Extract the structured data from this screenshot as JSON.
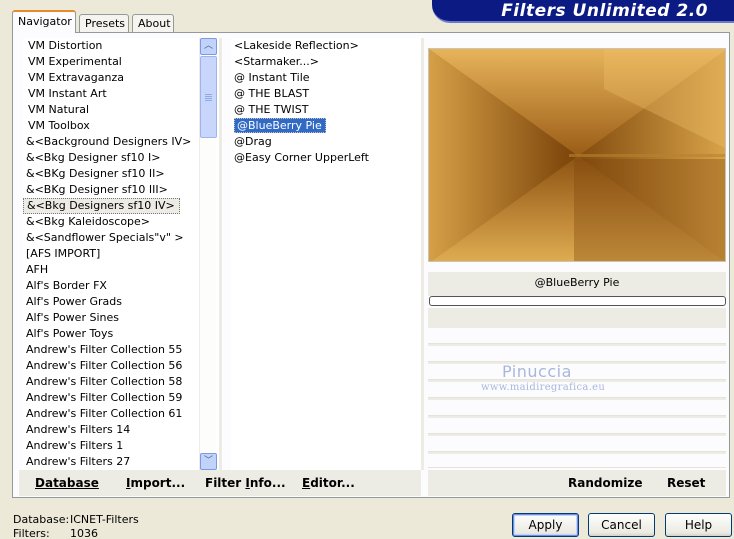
{
  "banner": {
    "title": "Filters Unlimited 2.0"
  },
  "tabs": [
    {
      "label": "Navigator",
      "active": true
    },
    {
      "label": "Presets",
      "active": false
    },
    {
      "label": "About",
      "active": false
    }
  ],
  "categories": [
    "VM Distortion",
    "VM Experimental",
    "VM Extravaganza",
    "VM Instant Art",
    "VM Natural",
    "VM Toolbox",
    "&<Background Designers IV>",
    "&<Bkg Designer sf10 I>",
    "&<BKg Designer sf10 II>",
    "&<BKg Designer sf10 III>",
    "&<Bkg Designers sf10 IV>",
    "&<Bkg Kaleidoscope>",
    "&<Sandflower Specials\"v\" >",
    "[AFS IMPORT]",
    "AFH",
    "Alf's Border FX",
    "Alf's Power Grads",
    "Alf's Power Sines",
    "Alf's Power Toys",
    "Andrew's Filter Collection 55",
    "Andrew's Filter Collection 56",
    "Andrew's Filter Collection 58",
    "Andrew's Filter Collection 59",
    "Andrew's Filter Collection 61",
    "Andrew's Filters 14",
    "Andrew's Filters 1",
    "Andrew's Filters 27"
  ],
  "selected_category_index": 10,
  "filters": [
    "<Lakeside Reflection>",
    "<Starmaker...>",
    "@ Instant Tile",
    "@ THE BLAST",
    "@ THE TWIST",
    "@BlueBerry Pie",
    "@Drag",
    "@Easy Corner UpperLeft"
  ],
  "selected_filter_index": 5,
  "preview": {
    "filter_name": "@BlueBerry Pie"
  },
  "watermark": {
    "line1": "Pinuccia",
    "line2": "www.maidiregrafica.eu"
  },
  "toolbar_left": {
    "database": "Database",
    "import_u": "I",
    "import_rest": "mport...",
    "filter_info_pre": "Filter ",
    "filter_info_u": "I",
    "filter_info_rest": "nfo...",
    "editor_pre": "Editor...",
    "database_u": "D",
    "database_rest": "atabase",
    "editor_u": "E",
    "editor_rest": "ditor..."
  },
  "toolbar_right": {
    "randomize": "Randomize",
    "reset": "Reset"
  },
  "footer": {
    "database_label": "Database:",
    "database_value": "ICNET-Filters",
    "filters_label": "Filters:",
    "filters_value": "1036"
  },
  "buttons": {
    "apply": "Apply",
    "cancel": "Cancel",
    "help": "Help"
  },
  "colors": {
    "banner": "#0c1a83",
    "selection": "#316ac5",
    "tab_accent": "#e68b2c"
  }
}
